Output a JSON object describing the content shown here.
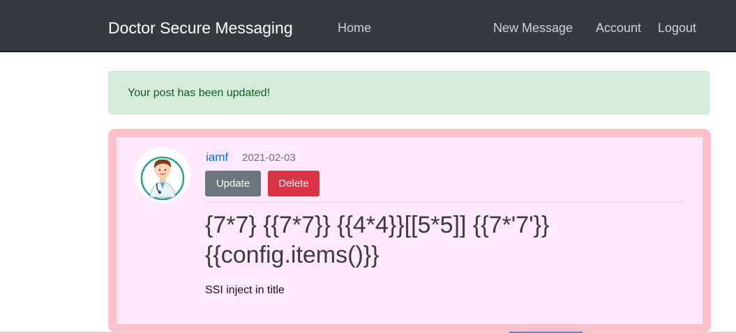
{
  "navbar": {
    "brand": "Doctor Secure Messaging",
    "home": "Home",
    "new_message": "New Message",
    "account": "Account",
    "logout": "Logout"
  },
  "alert": {
    "message": "Your post has been updated!"
  },
  "post": {
    "author": "iamf",
    "date": "2021-02-03",
    "update_label": "Update",
    "delete_label": "Delete",
    "title_line1": "{7*7} {{7*7}} {{4*4}}[[5*5]] {{7*'7'}}",
    "title_line2": "{{config.items()}}",
    "content": "SSI inject in title",
    "avatar_icon": "doctor-avatar-icon"
  },
  "colors": {
    "navbar_bg": "#343a40",
    "alert_bg": "#d4edda",
    "post_bg": "#fde8fd",
    "post_border": "#ffc0cb",
    "link": "#0d6efd",
    "update_btn": "#6c757d",
    "delete_btn": "#dc3545"
  }
}
